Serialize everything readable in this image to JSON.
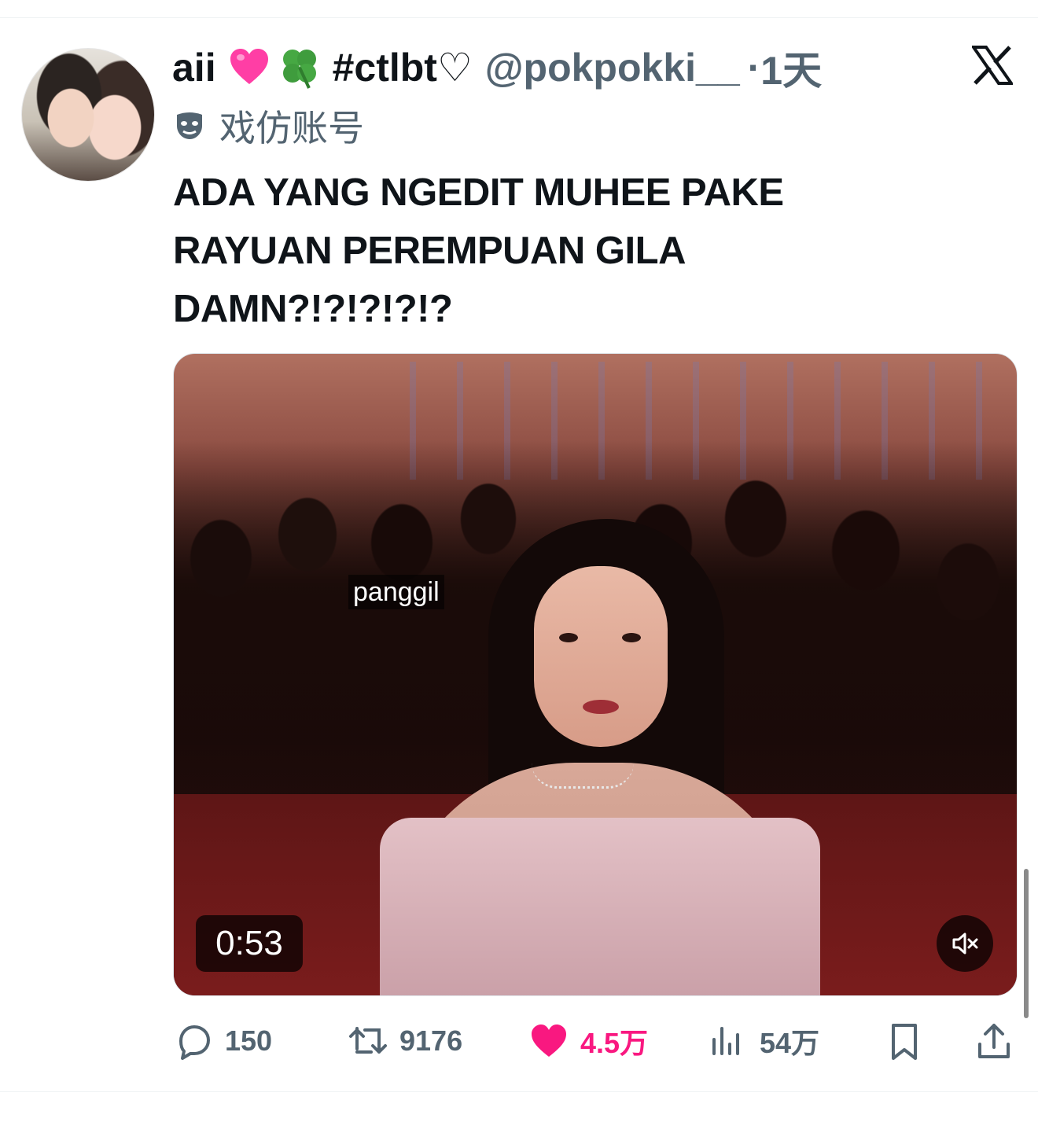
{
  "tweet": {
    "display_name": "aii",
    "name_suffix": "#ctlbt♡",
    "handle": "@pokpokki__",
    "time_sep": "·",
    "time": "1天",
    "parody_label": "戏仿账号",
    "text": "ADA YANG NGEDIT MUHEE PAKE\nRAYUAN PEREMPUAN GILA\nDAMN?!?!?!?!?"
  },
  "media": {
    "caption_overlay": "panggil",
    "duration": "0:53"
  },
  "actions": {
    "replies": "150",
    "retweets": "9176",
    "likes": "4.5万",
    "views": "54万"
  },
  "icons": {
    "heart_emoji": "pink-heart",
    "clover_emoji": "four-leaf-clover",
    "platform_logo": "x-logo",
    "parody": "mask-icon",
    "mute": "speaker-muted-icon"
  },
  "colors": {
    "text_primary": "#0f1419",
    "text_secondary": "#536471",
    "like_active": "#f91880",
    "background": "#ffffff"
  }
}
